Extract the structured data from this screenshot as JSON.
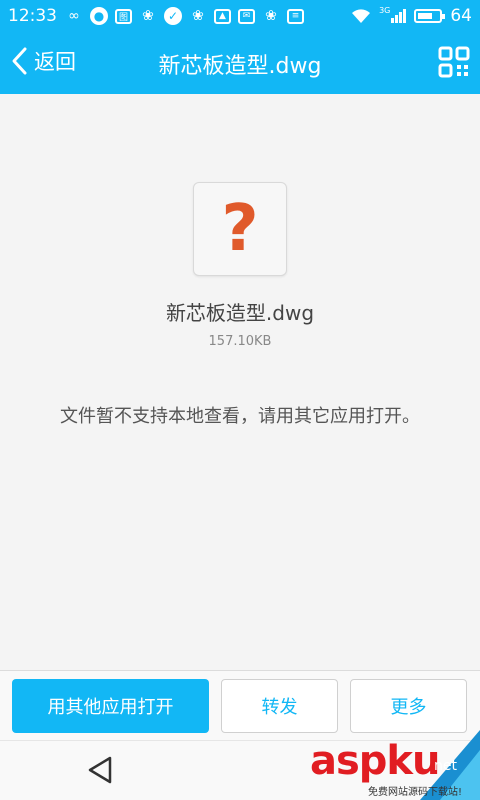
{
  "status_bar": {
    "time": "12:33",
    "battery_level": "64",
    "signal_label": "3G",
    "icons": [
      "infinity-icon",
      "chat-bubble-icon",
      "app-icon",
      "paw-icon",
      "check-circle-icon",
      "paw-icon",
      "image-icon",
      "mail-icon",
      "paw-icon",
      "document-icon",
      "wifi-icon",
      "signal-icon",
      "battery-icon"
    ]
  },
  "title_bar": {
    "back_label": "返回",
    "title": "新芯板造型.dwg",
    "right_icon": "qr-code-icon"
  },
  "file": {
    "icon_glyph": "?",
    "name": "新芯板造型.dwg",
    "size": "157.10KB",
    "notice": "文件暂不支持本地查看，请用其它应用打开。"
  },
  "actions": {
    "open_with_label": "用其他应用打开",
    "forward_label": "转发",
    "more_label": "更多"
  },
  "watermark": {
    "brand": "aspku",
    "tagline": "免费网站源码下载站!",
    "suffix": "net"
  },
  "colors": {
    "primary": "#12b7f5",
    "question_mark": "#e05a2b",
    "watermark_red": "#e11d22"
  }
}
